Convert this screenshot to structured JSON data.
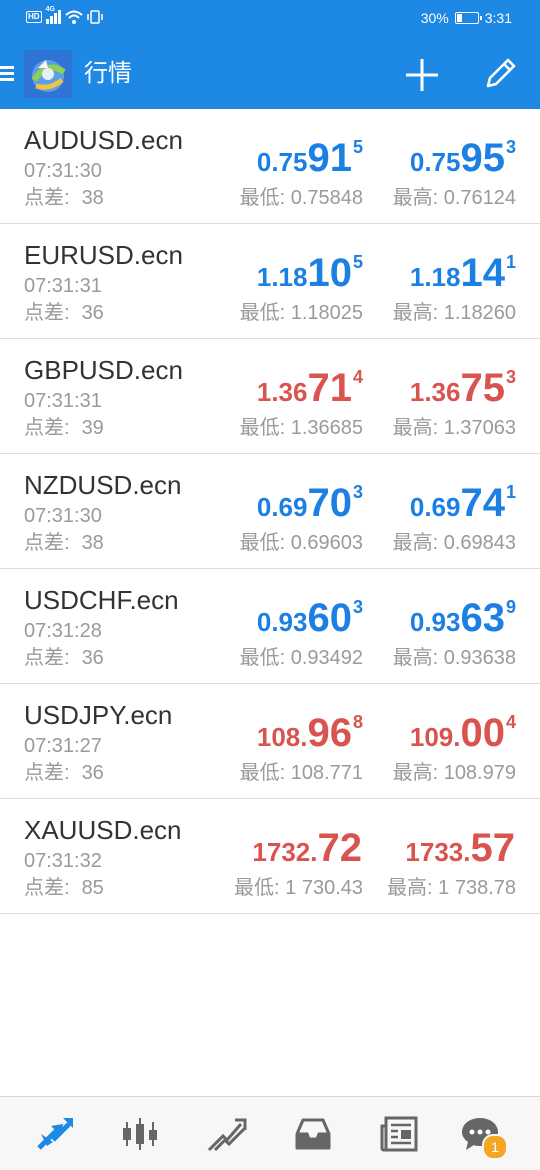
{
  "status_bar": {
    "hd": "HD",
    "network": "4G",
    "battery_percent": "30%",
    "battery_level": 0.3,
    "time": "3:31"
  },
  "app_bar": {
    "title": "行情",
    "menu_icon": "hamburger-menu-icon",
    "logo_icon": "metatrader-logo-icon",
    "add_icon": "plus-icon",
    "edit_icon": "pencil-icon"
  },
  "colors": {
    "primary": "#1e88e5",
    "price_up": "#1b7fe3",
    "price_down": "#d9534f",
    "muted_text": "#9a9a9a",
    "badge": "#f5a623"
  },
  "quotes": [
    {
      "symbol": "AUDUSD.ecn",
      "time": "07:31:30",
      "spread_label": "点差:",
      "spread": "38",
      "direction": "up",
      "bid": {
        "small": "0.75",
        "big": "91",
        "sup": "5"
      },
      "ask": {
        "small": "0.75",
        "big": "95",
        "sup": "3"
      },
      "low": "最低: 0.75848",
      "high": "最高: 0.76124"
    },
    {
      "symbol": "EURUSD.ecn",
      "time": "07:31:31",
      "spread_label": "点差:",
      "spread": "36",
      "direction": "up",
      "bid": {
        "small": "1.18",
        "big": "10",
        "sup": "5"
      },
      "ask": {
        "small": "1.18",
        "big": "14",
        "sup": "1"
      },
      "low": "最低: 1.18025",
      "high": "最高: 1.18260"
    },
    {
      "symbol": "GBPUSD.ecn",
      "time": "07:31:31",
      "spread_label": "点差:",
      "spread": "39",
      "direction": "down",
      "bid": {
        "small": "1.36",
        "big": "71",
        "sup": "4"
      },
      "ask": {
        "small": "1.36",
        "big": "75",
        "sup": "3"
      },
      "low": "最低: 1.36685",
      "high": "最高: 1.37063"
    },
    {
      "symbol": "NZDUSD.ecn",
      "time": "07:31:30",
      "spread_label": "点差:",
      "spread": "38",
      "direction": "up",
      "bid": {
        "small": "0.69",
        "big": "70",
        "sup": "3"
      },
      "ask": {
        "small": "0.69",
        "big": "74",
        "sup": "1"
      },
      "low": "最低: 0.69603",
      "high": "最高: 0.69843"
    },
    {
      "symbol": "USDCHF.ecn",
      "time": "07:31:28",
      "spread_label": "点差:",
      "spread": "36",
      "direction": "up",
      "bid": {
        "small": "0.93",
        "big": "60",
        "sup": "3"
      },
      "ask": {
        "small": "0.93",
        "big": "63",
        "sup": "9"
      },
      "low": "最低: 0.93492",
      "high": "最高: 0.93638"
    },
    {
      "symbol": "USDJPY.ecn",
      "time": "07:31:27",
      "spread_label": "点差:",
      "spread": "36",
      "direction": "down",
      "bid": {
        "small": "108.",
        "big": "96",
        "sup": "8"
      },
      "ask": {
        "small": "109.",
        "big": "00",
        "sup": "4"
      },
      "low": "最低: 108.771",
      "high": "最高: 108.979"
    },
    {
      "symbol": "XAUUSD.ecn",
      "time": "07:31:32",
      "spread_label": "点差:",
      "spread": "85",
      "direction": "down",
      "bid": {
        "small": "1732.",
        "big": "72",
        "sup": ""
      },
      "ask": {
        "small": "1733.",
        "big": "57",
        "sup": ""
      },
      "low": "最低: 1 730.43",
      "high": "最高: 1 738.78"
    }
  ],
  "bottom_nav": {
    "items": [
      {
        "icon": "quotes-arrows-icon",
        "active": true
      },
      {
        "icon": "candlestick-chart-icon",
        "active": false
      },
      {
        "icon": "trade-icon",
        "active": false
      },
      {
        "icon": "history-inbox-icon",
        "active": false
      },
      {
        "icon": "news-icon",
        "active": false
      },
      {
        "icon": "chat-icon",
        "active": false
      }
    ],
    "chat_badge": "1"
  }
}
